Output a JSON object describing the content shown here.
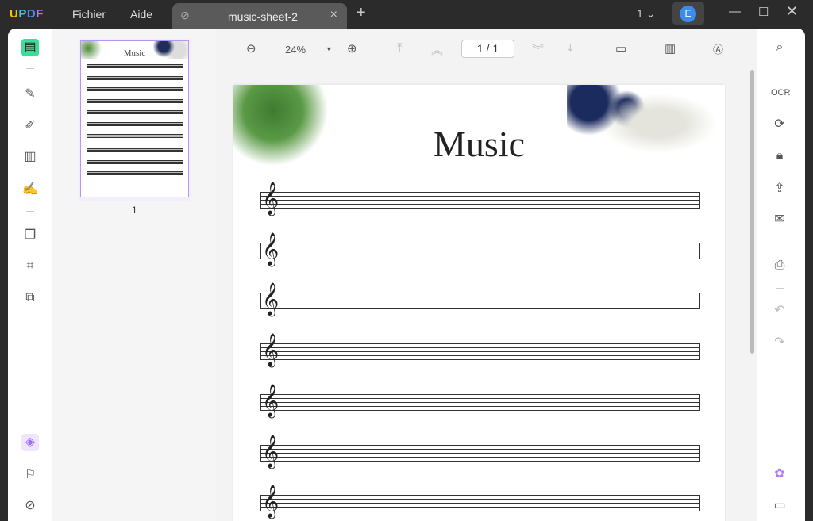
{
  "app": {
    "logo": "UPDF",
    "menu": [
      "Fichier",
      "Aide"
    ],
    "tab_title": "music-sheet-2",
    "window_count": "1",
    "avatar_letter": "E"
  },
  "toolbar": {
    "zoom": "24%",
    "page_indicator": "1 / 1"
  },
  "thumbnail": {
    "page_number": "1",
    "title": "Music"
  },
  "document": {
    "title": "Music",
    "staff_count": 7
  },
  "colors": {
    "accent": "#b894f5",
    "avatar": "#3c8cf0",
    "titlebar": "#2b2b2b"
  }
}
